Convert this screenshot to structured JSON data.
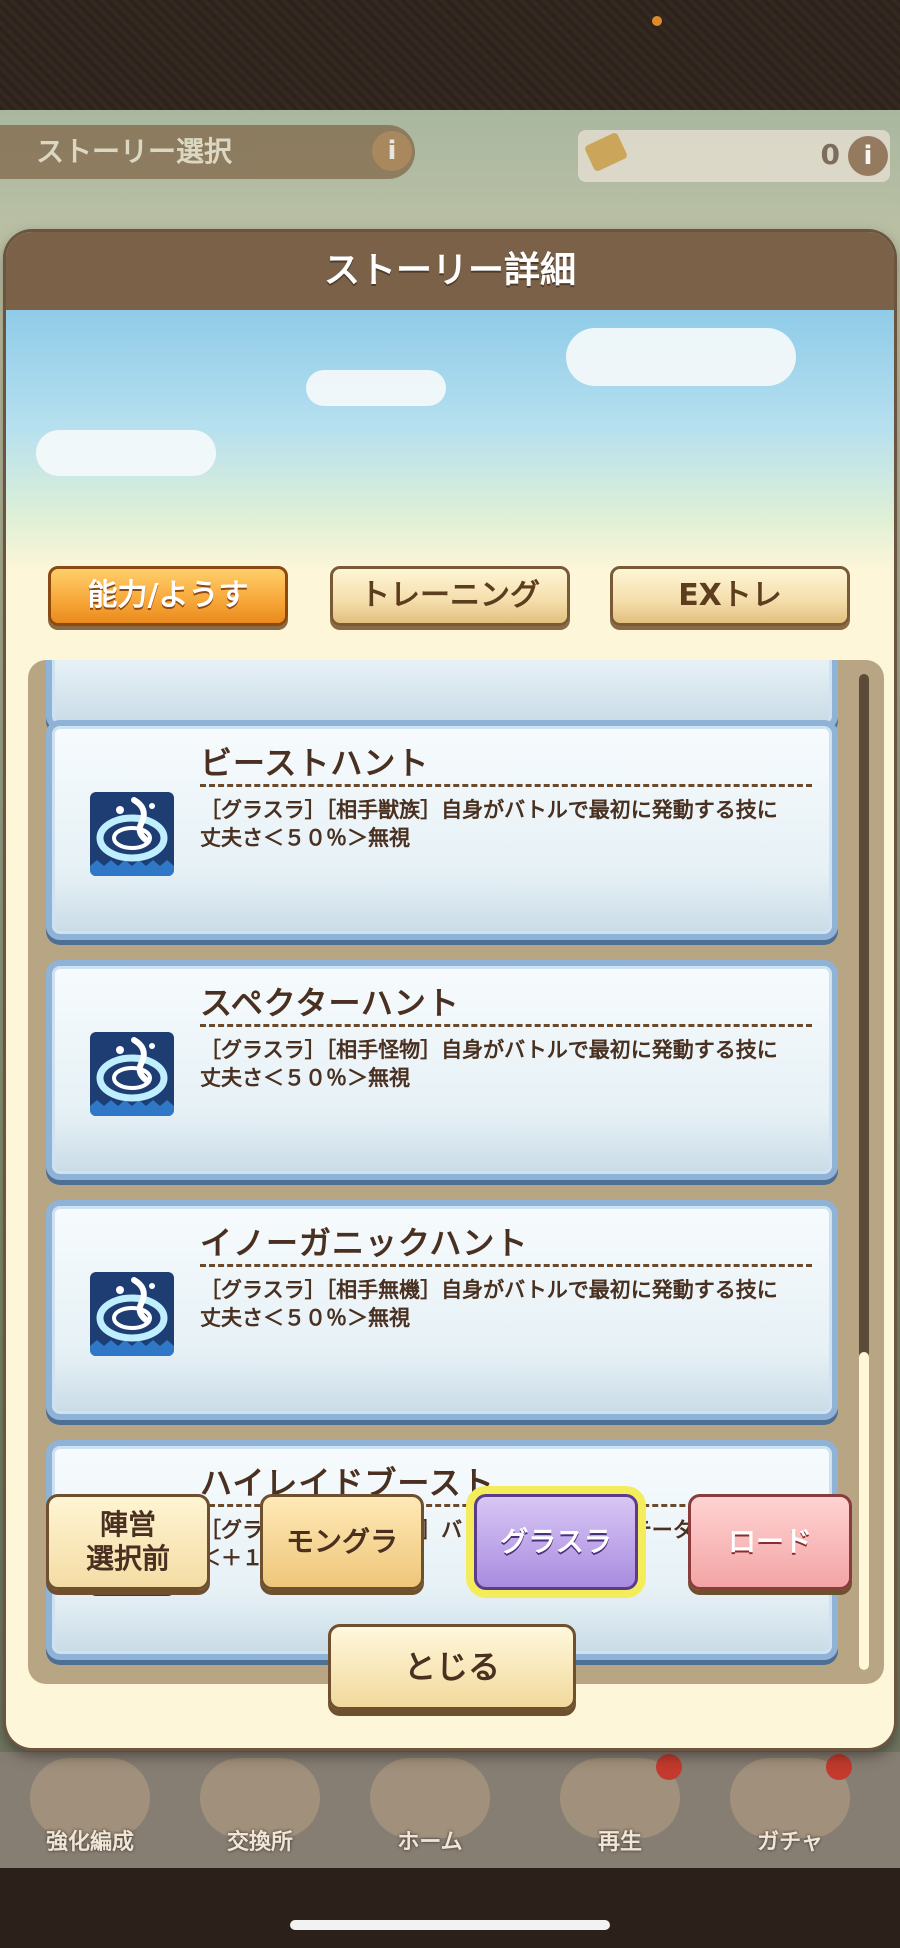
{
  "background": {
    "screen_title": "ストーリー選択",
    "info_glyph": "i",
    "currency_value": "0",
    "nav": [
      {
        "label": "強化編成"
      },
      {
        "label": "交換所"
      },
      {
        "label": "ホーム"
      },
      {
        "label": "再生"
      },
      {
        "label": "ガチャ"
      }
    ]
  },
  "modal": {
    "title": "ストーリー詳細",
    "tabs": [
      {
        "label": "能力/ようす",
        "active": true
      },
      {
        "label": "トレーニング",
        "active": false
      },
      {
        "label": "EXトレ",
        "active": false
      }
    ],
    "abilities": [
      {
        "name": "ビーストハント",
        "description": "［グラスラ］［相手獣族］自身がバトルで最初に発動する技に\n丈夫さ＜５０％＞無視",
        "icon": "wave-slash-icon"
      },
      {
        "name": "スペクターハント",
        "description": "［グラスラ］［相手怪物］自身がバトルで最初に発動する技に\n丈夫さ＜５０％＞無視",
        "icon": "wave-slash-icon"
      },
      {
        "name": "イノーガニックハント",
        "description": "［グラスラ］［相手無機］自身がバトルで最初に発動する技に\n丈夫さ＜５０％＞無視",
        "icon": "wave-slash-icon"
      },
      {
        "name": "ハイレイドブースト",
        "description": "［グラスラ決戦］［有利］バトル開始時、全ステータス\n＜＋１０００＞",
        "icon": "stat-bars-up-icon"
      }
    ],
    "modes": {
      "prepare": "陣営\n選択前",
      "mongura": "モングラ",
      "gurasura": "グラスラ",
      "road": "ロード"
    },
    "close_label": "とじる"
  },
  "colors": {
    "accent_orange": "#f7a638",
    "card_border": "#8fb3d6",
    "selected_mode": "#a98ce0",
    "highlight": "#f4ec5a"
  }
}
